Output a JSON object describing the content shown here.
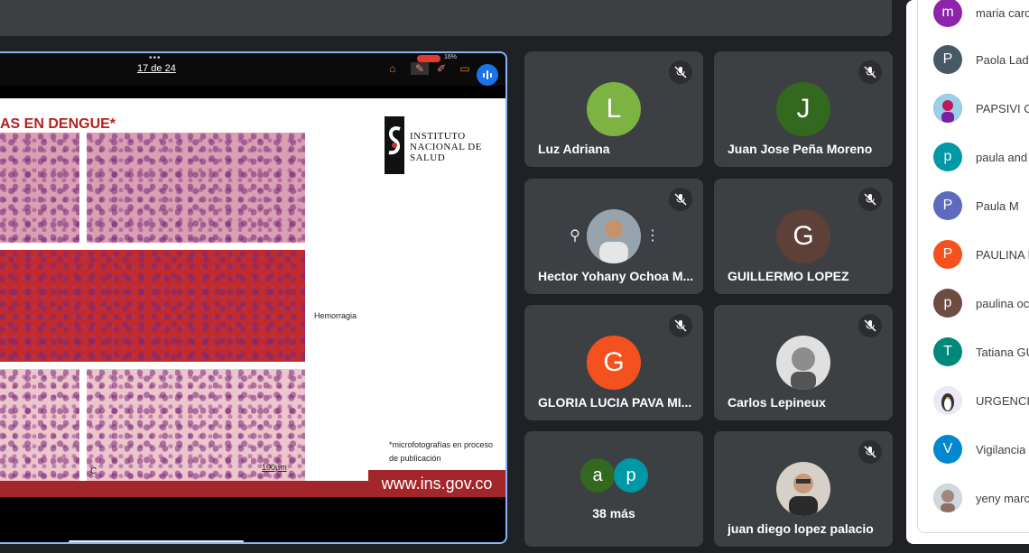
{
  "presentation": {
    "page": "17 de 24",
    "status": "16%",
    "slide": {
      "title": "AS EN DENGUE*",
      "institute": [
        "INSTITUTO",
        "NACIONAL DE",
        "SALUD"
      ],
      "hemorrhage_label": "Hemorragia",
      "footnote": "*microfotografías en proceso de publicación",
      "scale": "100µm",
      "panel_letter": "C",
      "url": "www.ins.gov.co"
    }
  },
  "tiles": [
    {
      "name": "Luz Adriana",
      "initial": "L",
      "color": "#7cb342",
      "muted": true
    },
    {
      "name": "Juan Jose Peña Moreno",
      "initial": "J",
      "color": "#33691e",
      "muted": true
    },
    {
      "name": "Hector Yohany Ochoa M...",
      "photo": true,
      "muted": true
    },
    {
      "name": "GUILLERMO LOPEZ",
      "initial": "G",
      "color": "#5d4037",
      "muted": true
    },
    {
      "name": "GLORIA LUCIA PAVA MI...",
      "initial": "G",
      "color": "#f4511e",
      "muted": true
    },
    {
      "name": "Carlos Lepineux",
      "photo": true,
      "muted": true
    },
    {
      "name": "juan diego lopez palacio",
      "photo": true,
      "muted": true
    }
  ],
  "more": {
    "label": "38 más",
    "avatars": [
      {
        "initial": "a",
        "color": "#33691e"
      },
      {
        "initial": "p",
        "color": "#0097a7"
      }
    ]
  },
  "people": [
    {
      "name": "maria caro",
      "initial": "m",
      "color": "#8e24aa"
    },
    {
      "name": "Paola Lad",
      "initial": "P",
      "color": "#455a64"
    },
    {
      "name": "PAPSIVI C",
      "initial": "",
      "color": "#c2185b"
    },
    {
      "name": "paula and",
      "initial": "p",
      "color": "#0097a7"
    },
    {
      "name": "Paula M",
      "initial": "P",
      "color": "#5c6bc0"
    },
    {
      "name": "PAULINA I",
      "initial": "P",
      "color": "#f4511e"
    },
    {
      "name": "paulina oc",
      "initial": "p",
      "color": "#6d4c41"
    },
    {
      "name": "Tatiana GU",
      "initial": "T",
      "color": "#00897b"
    },
    {
      "name": "URGENCI",
      "initial": "",
      "color": "#e0e0e0"
    },
    {
      "name": "Vigilancia",
      "initial": "V",
      "color": "#0288d1"
    },
    {
      "name": "yeny marc",
      "initial": "",
      "color": "#bcaaa4"
    }
  ],
  "icons": {
    "mic_off": "mic-off-icon",
    "pin": "pin-icon",
    "more": "more-vert-icon"
  }
}
